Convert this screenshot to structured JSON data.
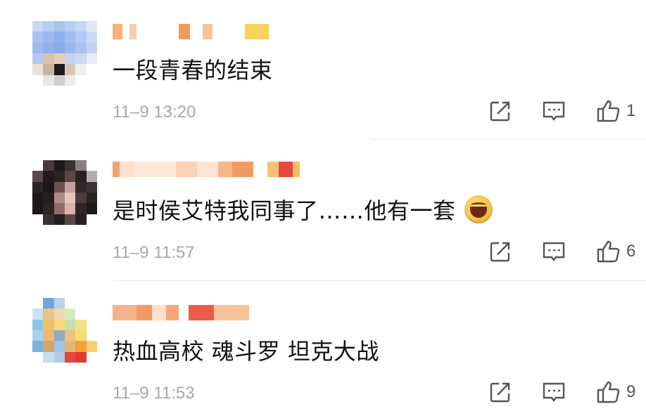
{
  "comments": [
    {
      "text": "一段青春的结束",
      "time": "11–9 13:20",
      "likes": "1",
      "emoji": ""
    },
    {
      "text": "是时侯艾特我同事了……他有一套",
      "time": "11–9 11:57",
      "likes": "6",
      "emoji": "laughing-emoji"
    },
    {
      "text": "热血高校 魂斗罗 坦克大战",
      "time": "11–9 11:53",
      "likes": "9",
      "emoji": ""
    }
  ],
  "icons": {
    "share": "share-icon",
    "reply": "comment-icon",
    "like": "thumbs-up-icon"
  },
  "colors": {
    "text": "#111111",
    "timestamp": "#a8a8a8",
    "icon": "#555555",
    "divider": "#e8e8e8"
  }
}
